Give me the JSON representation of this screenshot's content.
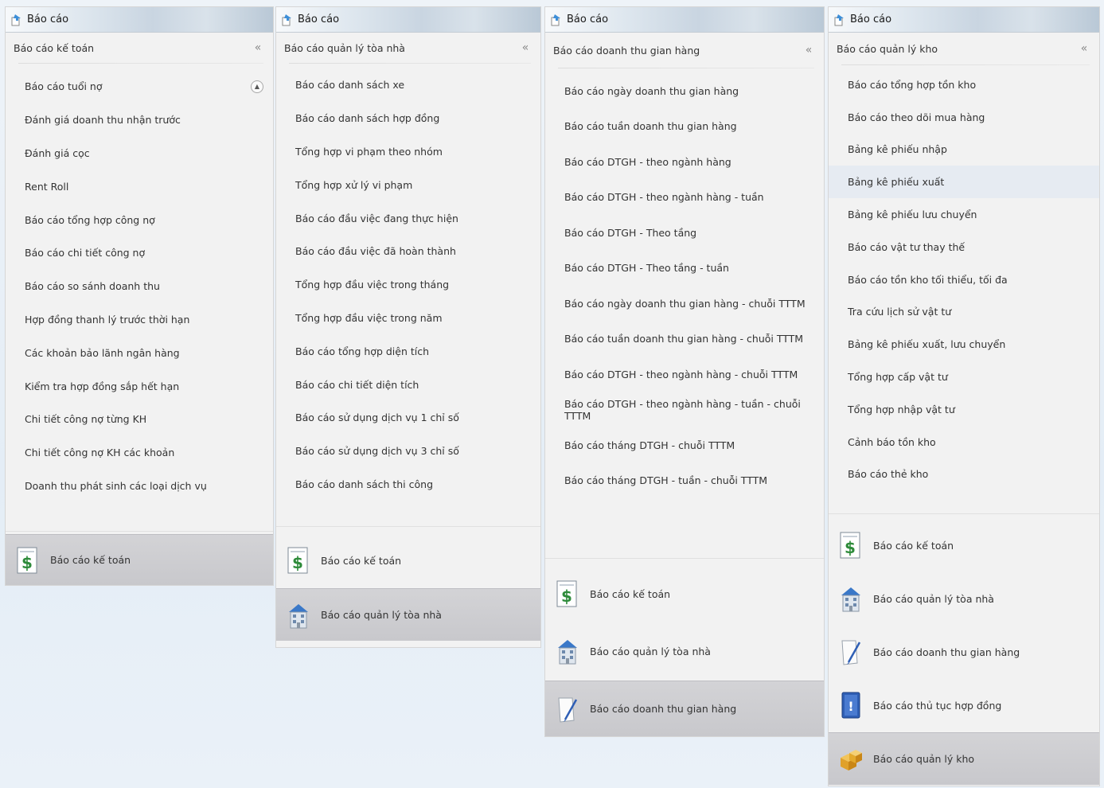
{
  "colors": {
    "selected_bg": "#cbcbcf",
    "panel_bg": "#f2f2f2",
    "money_green": "#2e8b3a",
    "building_blue": "#3a78c8",
    "doc_blue": "#2f5fb5",
    "box_gold": "#e4a92b"
  },
  "panels": [
    {
      "title": "Báo cáo",
      "group_title": "Báo cáo kế toán",
      "collapse_icon": "«",
      "items": [
        "Báo cáo tuổi nợ",
        "Đánh giá doanh thu nhận trước",
        "Đánh giá cọc",
        "Rent Roll",
        "Báo cáo tổng hợp công nợ",
        "Báo cáo chi tiết công nợ",
        "Báo cáo so sánh doanh thu",
        "Hợp đồng thanh lý trước thời hạn",
        "Các khoản bảo lãnh ngân hàng",
        "Kiểm tra hợp đồng sắp hết hạn",
        "Chi tiết công nợ từng KH",
        "Chi tiết công nợ KH các khoản",
        "Doanh thu phát sinh các loại dịch vụ"
      ],
      "nav": [
        "Báo cáo kế toán"
      ]
    },
    {
      "title": "Báo cáo",
      "group_title": "Báo cáo quản lý tòa nhà",
      "collapse_icon": "«",
      "items": [
        "Báo cáo danh sách xe",
        "Báo cáo danh sách hợp đồng",
        "Tổng hợp vi phạm theo nhóm",
        "Tổng hợp xử lý vi phạm",
        "Báo cáo đầu việc đang thực hiện",
        "Báo cáo đầu việc đã hoàn thành",
        "Tổng hợp đầu việc trong tháng",
        "Tổng hợp đầu việc trong năm",
        "Báo cáo tổng hợp diện tích",
        "Báo cáo chi tiết diện tích",
        "Báo cáo sử dụng dịch vụ 1 chỉ số",
        "Báo cáo sử dụng dịch vụ 3 chỉ số",
        "Báo cáo danh sách thi công"
      ],
      "nav": [
        "Báo cáo kế toán",
        "Báo cáo quản lý tòa nhà"
      ]
    },
    {
      "title": "Báo cáo",
      "group_title": "Báo cáo doanh thu gian hàng",
      "collapse_icon": "«",
      "items": [
        "Báo cáo ngày doanh thu gian hàng",
        "Báo cáo tuần doanh thu gian hàng",
        "Báo cáo DTGH - theo ngành hàng",
        "Báo cáo DTGH - theo ngành hàng - tuần",
        "Báo cáo DTGH - Theo tầng",
        "Báo cáo DTGH - Theo tầng - tuần",
        "Báo cáo ngày doanh thu gian hàng - chuỗi TTTM",
        "Báo cáo tuần doanh thu gian hàng - chuỗi TTTM",
        "Báo cáo DTGH - theo ngành hàng - chuỗi TTTM",
        "Báo cáo DTGH - theo ngành hàng - tuần - chuỗi TTTM",
        "Báo cáo tháng DTGH - chuỗi TTTM",
        "Báo cáo tháng DTGH - tuần - chuỗi TTTM"
      ],
      "nav": [
        "Báo cáo kế toán",
        "Báo cáo quản lý tòa nhà",
        "Báo cáo doanh thu gian hàng"
      ]
    },
    {
      "title": "Báo cáo",
      "group_title": "Báo cáo quản lý kho",
      "collapse_icon": "«",
      "items": [
        "Báo cáo tổng hợp tồn kho",
        "Báo cáo theo dõi mua hàng",
        "Bảng kê phiếu nhập",
        "Bảng kê phiếu xuất",
        "Bảng kê phiếu lưu chuyển",
        "Báo cáo vật tư thay thế",
        "Báo cáo tồn kho tối thiểu, tối đa",
        "Tra cứu lịch sử vật tư",
        "Bảng kê phiếu xuất, lưu chuyển",
        "Tổng hợp cấp vật tư",
        "Tổng hợp nhập vật tư",
        "Cảnh báo tồn kho",
        "Báo cáo thẻ kho"
      ],
      "nav": [
        "Báo cáo kế toán",
        "Báo cáo quản lý tòa nhà",
        "Báo cáo doanh thu gian hàng",
        "Báo cáo thủ tục hợp đồng",
        "Báo cáo quản lý kho"
      ]
    }
  ]
}
